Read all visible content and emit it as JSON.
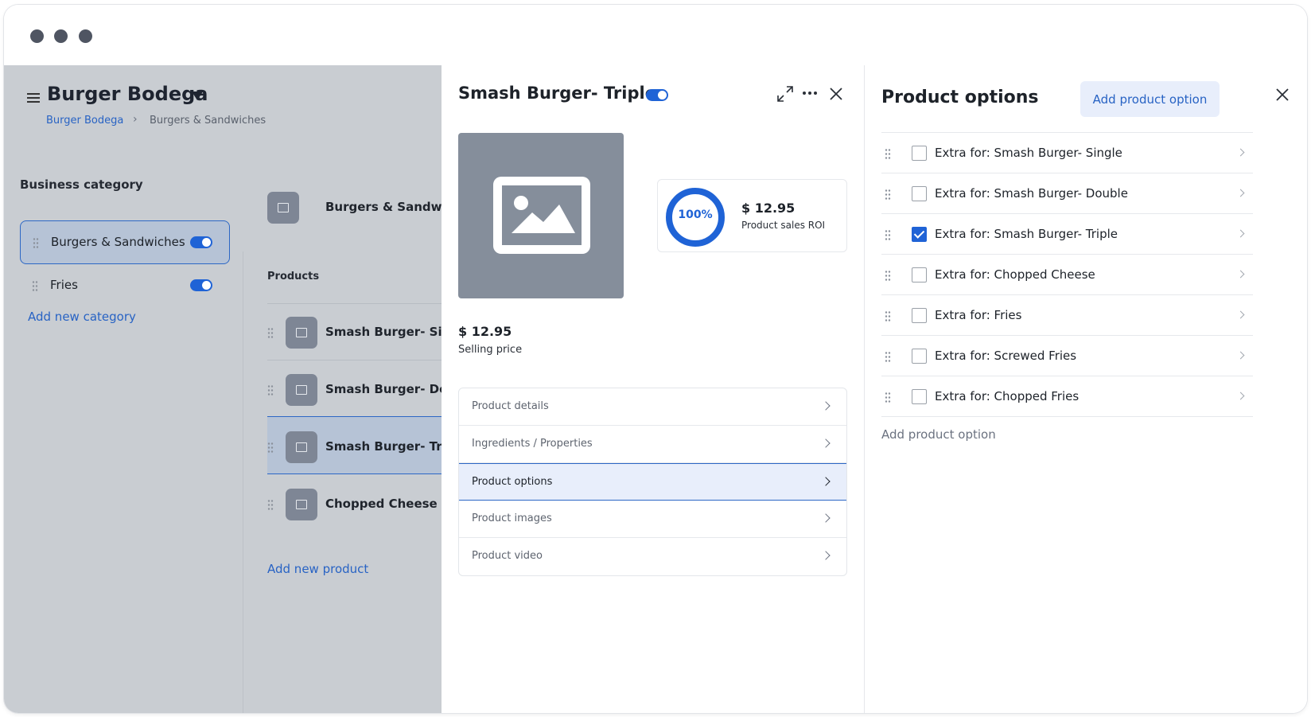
{
  "app": {
    "brand": "Burger Bodega",
    "breadcrumb": [
      "Burger Bodega",
      "Burgers & Sandwiches"
    ]
  },
  "sidebar": {
    "heading": "Business category",
    "categories": [
      {
        "label": "Burgers & Sandwiches",
        "enabled": true,
        "selected": true
      },
      {
        "label": "Fries",
        "enabled": true,
        "selected": false
      }
    ],
    "add_label": "Add new category"
  },
  "products_pane": {
    "category_title": "Burgers & Sandwiches",
    "heading": "Products",
    "items": [
      {
        "label": "Smash Burger- Single"
      },
      {
        "label": "Smash Burger- Double"
      },
      {
        "label": "Smash Burger- Triple",
        "selected": true
      },
      {
        "label": "Chopped Cheese"
      }
    ],
    "add_label": "Add new product"
  },
  "product": {
    "title": "Smash Burger- Triple",
    "enabled": true,
    "roi_percent": "100%",
    "roi_price": "$ 12.95",
    "roi_label": "Product sales ROI",
    "selling_price": "$ 12.95",
    "selling_label": "Selling price",
    "menu": [
      {
        "label": "Product details",
        "active": false
      },
      {
        "label": "Ingredients / Properties",
        "active": false
      },
      {
        "label": "Product options",
        "active": true
      },
      {
        "label": "Product images",
        "active": false
      },
      {
        "label": "Product video",
        "active": false
      }
    ]
  },
  "options_panel": {
    "title": "Product options",
    "add_button": "Add product option",
    "options": [
      {
        "label": "Extra for: Smash Burger- Single",
        "checked": false
      },
      {
        "label": "Extra for: Smash Burger- Double",
        "checked": false
      },
      {
        "label": "Extra for: Smash Burger- Triple",
        "checked": true
      },
      {
        "label": "Extra for: Chopped Cheese",
        "checked": false
      },
      {
        "label": "Extra for: Fries",
        "checked": false
      },
      {
        "label": "Extra for: Screwed Fries",
        "checked": false
      },
      {
        "label": "Extra for: Chopped Fries",
        "checked": false
      }
    ],
    "add_link": "Add product option"
  },
  "colors": {
    "accent": "#1f63d6",
    "link": "#2863c4",
    "overlay": "#c9cdd2",
    "selected_bg": "#e8eefb"
  }
}
